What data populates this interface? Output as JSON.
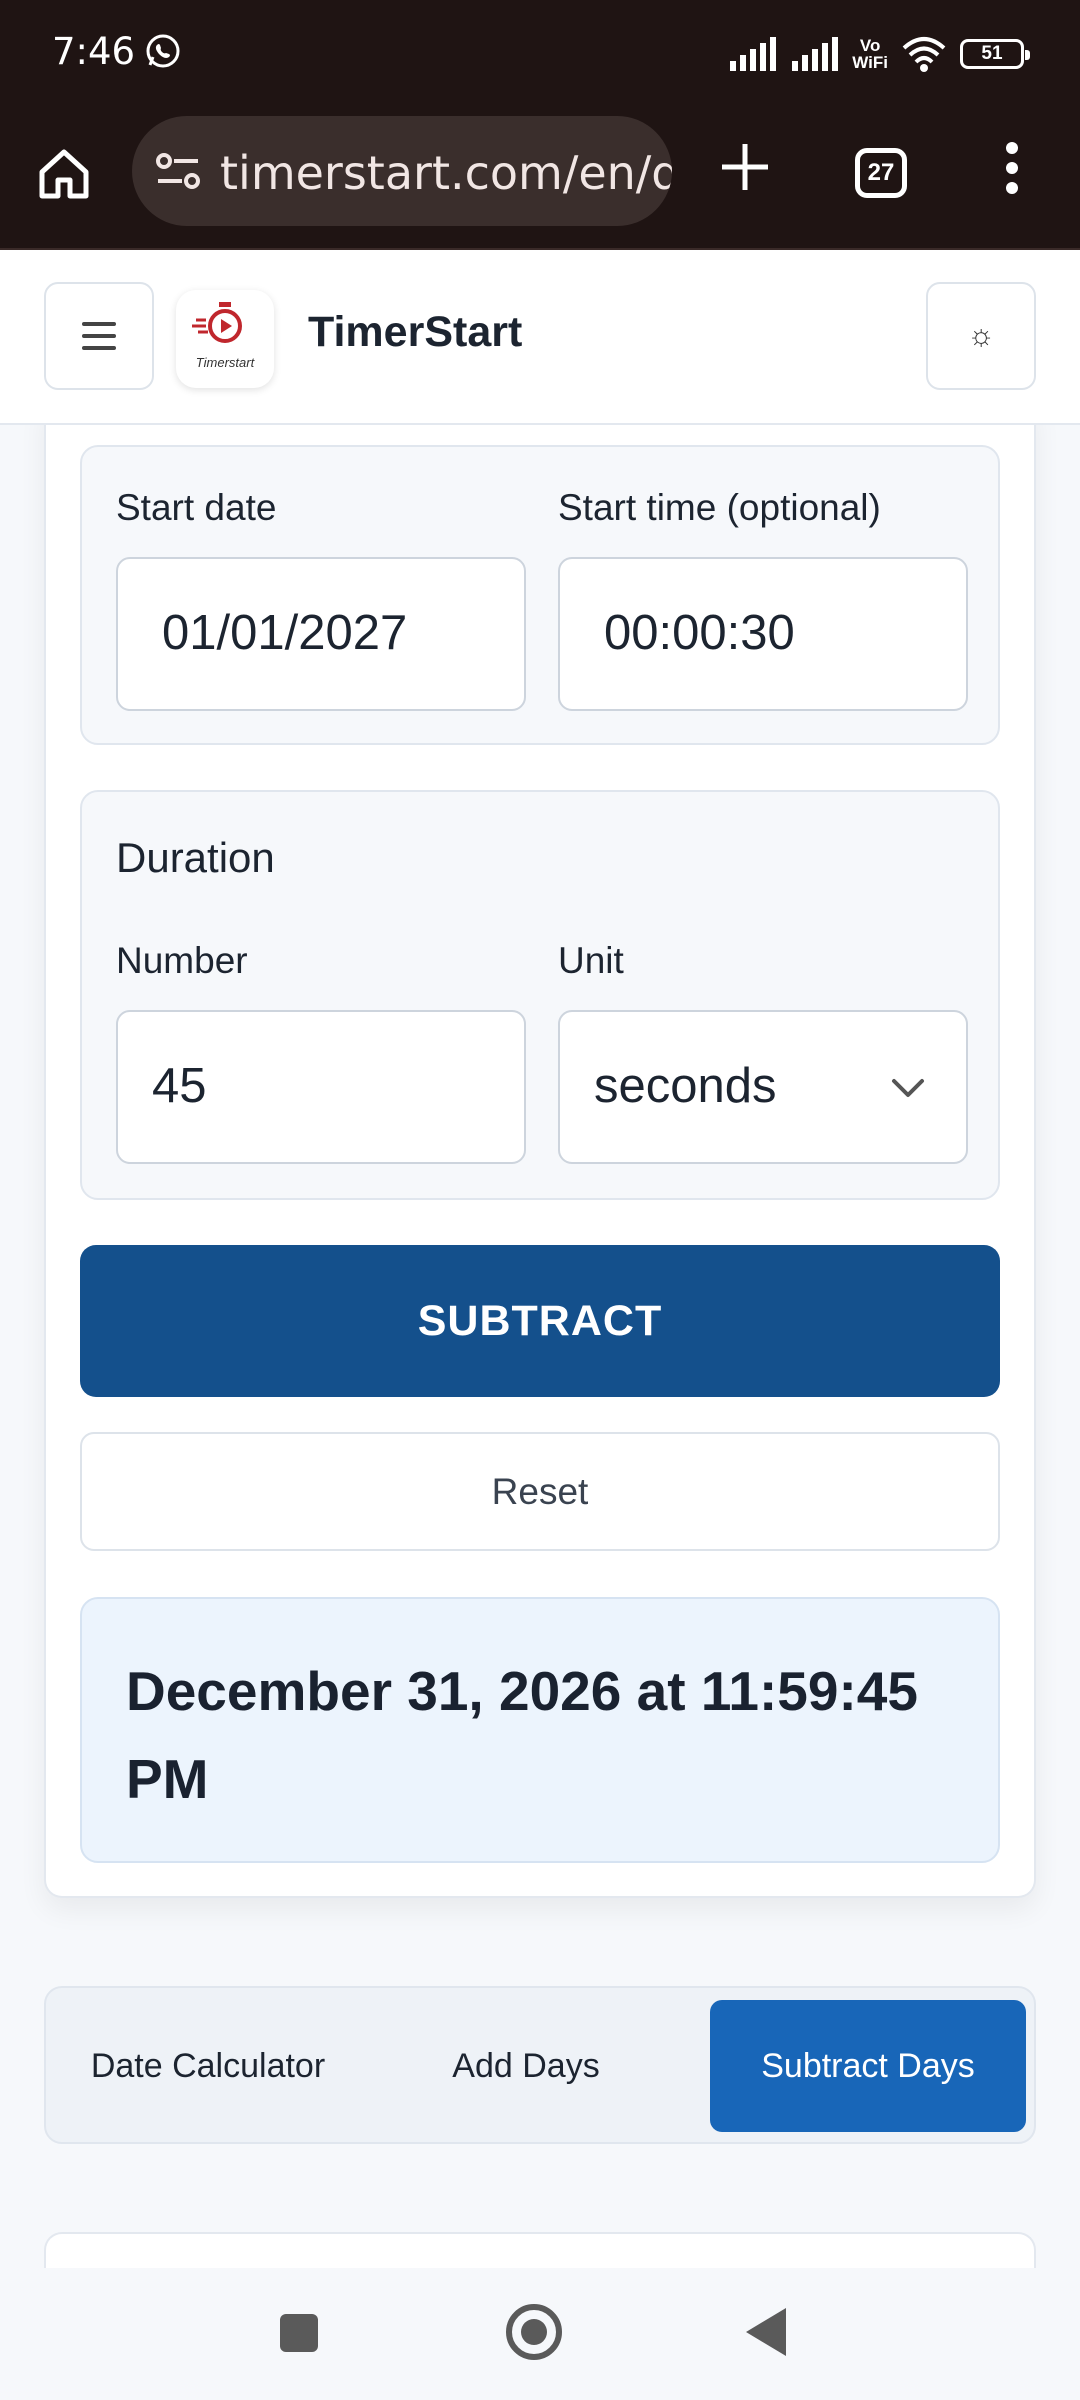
{
  "status_bar": {
    "time": "7:46",
    "network_label_top": "Vo",
    "network_label_bottom": "WiFi",
    "battery": "51"
  },
  "browser": {
    "url": "timerstart.com/en/d",
    "tab_count": "27"
  },
  "header": {
    "brand": "TimerStart",
    "logo_text": "Timerstart",
    "theme_icon": "☼"
  },
  "form": {
    "start_date_label": "Start date",
    "start_date_value": "01/01/2027",
    "start_time_label": "Start time (optional)",
    "start_time_value": "00:00:30",
    "duration_title": "Duration",
    "number_label": "Number",
    "number_value": "45",
    "unit_label": "Unit",
    "unit_value": "seconds",
    "subtract_label": "SUBTRACT",
    "reset_label": "Reset",
    "result": "December 31, 2026 at 11:59:45 PM"
  },
  "tabs": [
    {
      "label": "Date Calculator",
      "active": false
    },
    {
      "label": "Add Days",
      "active": false
    },
    {
      "label": "Subtract Days",
      "active": true
    }
  ],
  "colors": {
    "primary_button": "#14508c",
    "active_tab": "#1866b8",
    "result_bg": "#ecf4fd",
    "browser_chrome": "#1f1413"
  }
}
